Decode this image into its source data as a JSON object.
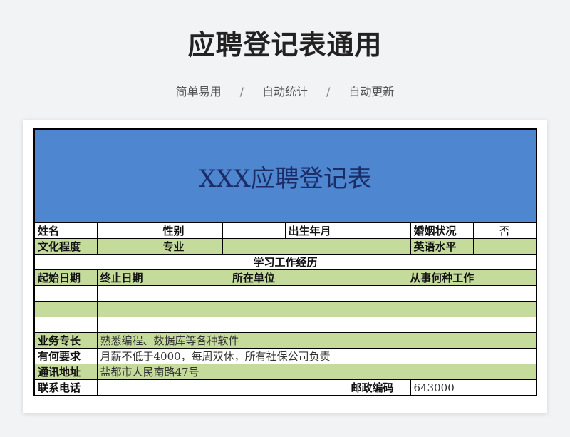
{
  "header": {
    "title": "应聘登记表通用",
    "tags": [
      "简单易用",
      "自动统计",
      "自动更新"
    ],
    "separator": "/"
  },
  "form": {
    "banner_title": "XXX应聘登记表",
    "row1": {
      "name_label": "姓名",
      "name_value": "",
      "gender_label": "性别",
      "gender_value": "",
      "birth_label": "出生年月",
      "birth_value": "",
      "marital_label": "婚姻状况",
      "marital_value": "否"
    },
    "row2": {
      "education_label": "文化程度",
      "education_value": "",
      "major_label": "专业",
      "major_value": "",
      "english_label": "英语水平",
      "english_value": ""
    },
    "history": {
      "section_title": "学习工作经历",
      "headers": [
        "起始日期",
        "终止日期",
        "所在单位",
        "从事何种工作"
      ],
      "rows": [
        [
          "",
          "",
          "",
          ""
        ],
        [
          "",
          "",
          "",
          ""
        ],
        [
          "",
          "",
          "",
          ""
        ]
      ]
    },
    "skills_label": "业务专长",
    "skills_value": "熟悉编程、数据库等各种软件",
    "requirements_label": "有何要求",
    "requirements_value": "月薪不低于4000，每周双休，所有社保公司负责",
    "address_label": "通讯地址",
    "address_value": "盐都市人民南路47号",
    "phone_label": "联系电话",
    "phone_value": "",
    "postcode_label": "邮政编码",
    "postcode_value": "643000"
  },
  "colors": {
    "banner_blue": "#4f86d0",
    "row_green": "#c4db9c",
    "background": "#f2f3f5"
  }
}
